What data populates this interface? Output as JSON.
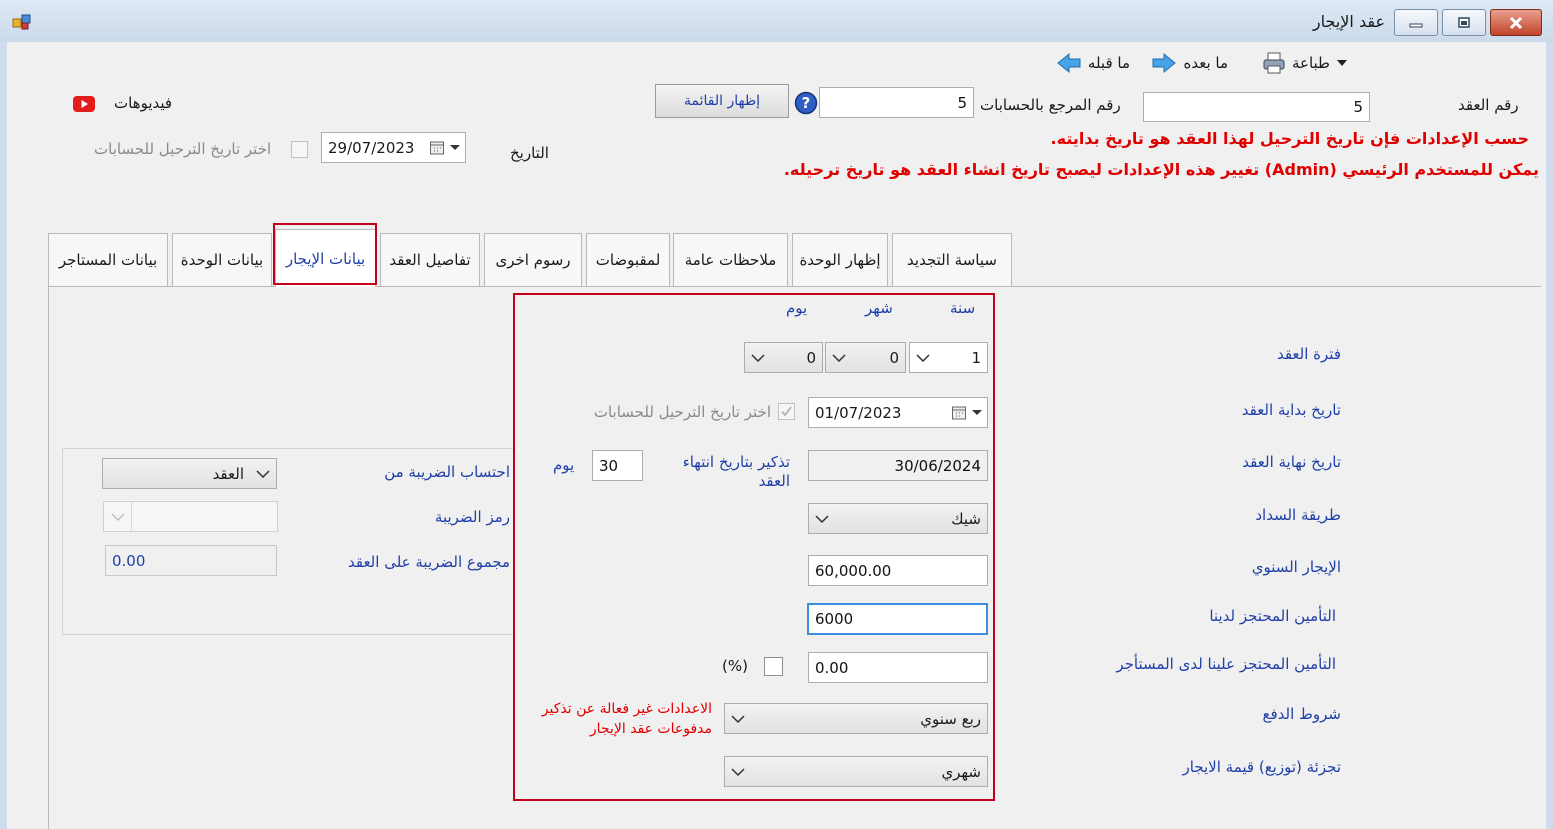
{
  "window": {
    "title": "عقد الإيجار",
    "controls": {
      "minimize": "minimize",
      "maximize": "maximize",
      "close": "close"
    }
  },
  "toolbar": {
    "print_label": "طباعة",
    "next_label": "ما بعده",
    "prev_label": "ما قبله"
  },
  "header": {
    "contract_no_label": "رقم العقد",
    "contract_no_value": "5",
    "ref_no_label": "رقم المرجع بالحسابات",
    "ref_no_value": "5",
    "show_list_button": "إظهار القائمة",
    "videos_label": "فيديوهات",
    "date_label": "التاريخ",
    "date_value": "29/07/2023",
    "posting_date_checkbox_label": "اختر تاريخ الترحيل للحسابات"
  },
  "notices": {
    "line1": "حسب الإعدادات فإن تاريخ الترحيل لهذا العقد هو تاريخ بدايته.",
    "line2": "يمكن للمستخدم الرئيسي (Admin) تغيير هذه الإعدادات ليصبح تاريخ انشاء العقد هو تاريخ ترحيله."
  },
  "tabs": [
    {
      "label": "سياسة التجديد",
      "active": false
    },
    {
      "label": "إظهار الوحدة",
      "active": false
    },
    {
      "label": "ملاحظات عامة",
      "active": false
    },
    {
      "label": "لمقبوضات",
      "active": false
    },
    {
      "label": "رسوم اخرى",
      "active": false
    },
    {
      "label": "تفاصيل العقد",
      "active": false
    },
    {
      "label": "بيانات الإيجار",
      "active": true
    },
    {
      "label": "بيانات الوحدة",
      "active": false
    },
    {
      "label": "بيانات المستاجر",
      "active": false
    }
  ],
  "rent": {
    "col_year": "سنة",
    "col_month": "شهر",
    "col_day": "يوم",
    "period_label": "فترة العقد",
    "period_years": "1",
    "period_months": "0",
    "period_days": "0",
    "start_label": "تاريخ بداية العقد",
    "start_value": "01/07/2023",
    "start_checkbox_label": "اختر تاريخ الترحيل للحسابات",
    "end_label": "تاريخ نهاية العقد",
    "end_value": "30/06/2024",
    "reminder_label": "تذكير بتاريخ انتهاء العقد",
    "reminder_value": "30",
    "reminder_unit": "يوم",
    "payment_method_label": "طريقة السداد",
    "payment_method_value": "شيك",
    "annual_rent_label": "الإيجار السنوي",
    "annual_rent_value": "60,000.00",
    "deposit_held_label": "التأمين المحتجز لدينا",
    "deposit_held_value": "6000",
    "deposit_tenant_label": "التأمين المحتجز علينا لدى المستأجر",
    "deposit_tenant_value": "0.00",
    "percent_label": "(%)",
    "payment_terms_label": "شروط الدفع",
    "payment_terms_value": "ربع سنوي",
    "payment_terms_note": "الاعدادات غير فعالة عن تذكير مدفوعات عقد الإيجار",
    "split_label": "تجزئة (توزيع) قيمة الايجار",
    "split_value": "شهري"
  },
  "tax": {
    "calc_from_label": "احتساب الضريبة من",
    "calc_from_value": "العقد",
    "code_label": "رمز الضريبة",
    "code_value": "",
    "total_label": "مجموع الضريبة على العقد",
    "total_value": "0.00"
  },
  "colors": {
    "label_blue": "#1f3fa8",
    "notice_red": "#e00000",
    "highlight_red": "#c4001a",
    "focus_blue": "#3c8ee0"
  }
}
